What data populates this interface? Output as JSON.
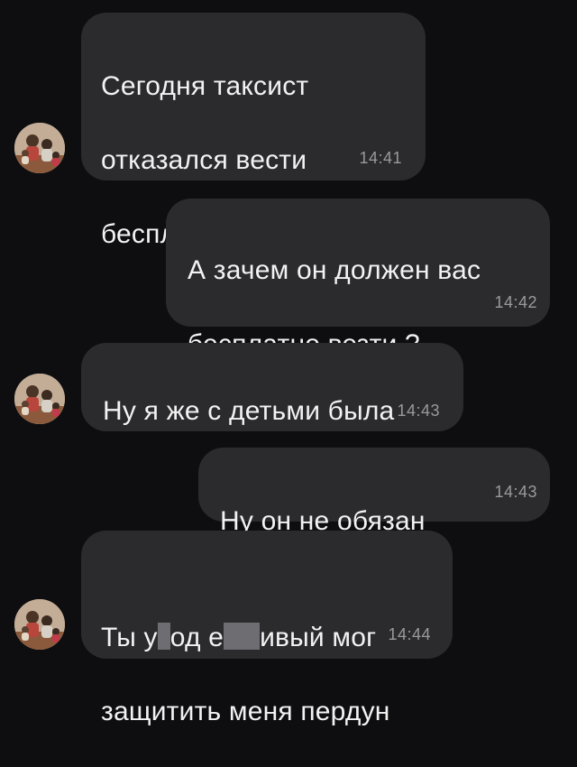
{
  "messages": [
    {
      "direction": "incoming",
      "lines": [
        "Сегодня таксист",
        "отказался вести",
        "бесплатно с детьми"
      ],
      "time": "14:41"
    },
    {
      "direction": "outgoing",
      "lines": [
        "А зачем он должен вас",
        "бесплатно везти ?"
      ],
      "time": "14:42"
    },
    {
      "direction": "incoming",
      "lines": [
        "Ну я же с детьми была"
      ],
      "time": "14:43"
    },
    {
      "direction": "outgoing",
      "lines": [
        "Ну он не обязан"
      ],
      "time": "14:43"
    },
    {
      "direction": "incoming",
      "line1_parts": [
        "Ты у",
        "од е",
        "ивый мог"
      ],
      "line2": "защитить меня пердун",
      "time": "14:44"
    }
  ],
  "colors": {
    "background": "#0e0e10",
    "bubble": "#2b2b2e",
    "text": "#f2f2f2",
    "timestamp": "#9a9a9e",
    "censor_block": "#6e6e72"
  },
  "icons": {
    "avatar": "group-photo-avatar"
  }
}
